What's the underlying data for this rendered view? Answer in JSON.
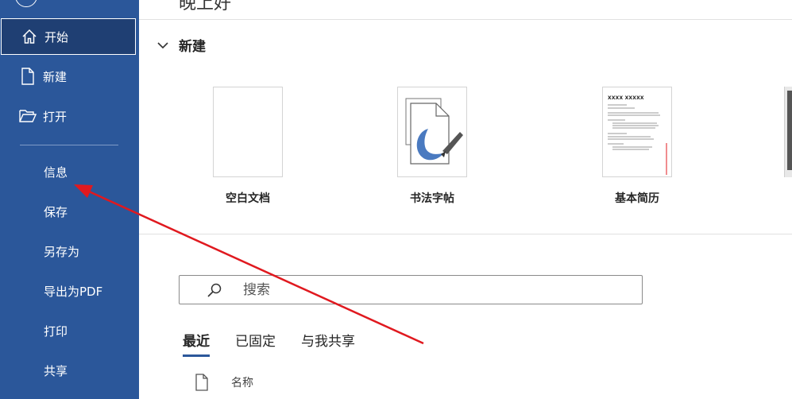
{
  "sidebar": {
    "items": [
      {
        "label": "开始",
        "icon": "home-icon",
        "selected": true
      },
      {
        "label": "新建",
        "icon": "new-document-icon"
      },
      {
        "label": "打开",
        "icon": "open-folder-icon"
      }
    ],
    "sub_items": [
      {
        "label": "信息"
      },
      {
        "label": "保存"
      },
      {
        "label": "另存为"
      },
      {
        "label": "导出为PDF"
      },
      {
        "label": "打印"
      },
      {
        "label": "共享"
      }
    ]
  },
  "main": {
    "greeting": "晚上好",
    "new_section": {
      "title": "新建",
      "templates": [
        {
          "label": "空白文档"
        },
        {
          "label": "书法字帖"
        },
        {
          "label": "基本简历",
          "thumb_title": "XXXX XXXXX"
        }
      ]
    },
    "search": {
      "placeholder": "搜索"
    },
    "tabs": [
      {
        "label": "最近",
        "active": true
      },
      {
        "label": "已固定"
      },
      {
        "label": "与我共享"
      }
    ],
    "file_list": {
      "column_name": "名称"
    }
  },
  "colors": {
    "sidebar": "#2b579a",
    "annotation_arrow": "#e0191f"
  }
}
